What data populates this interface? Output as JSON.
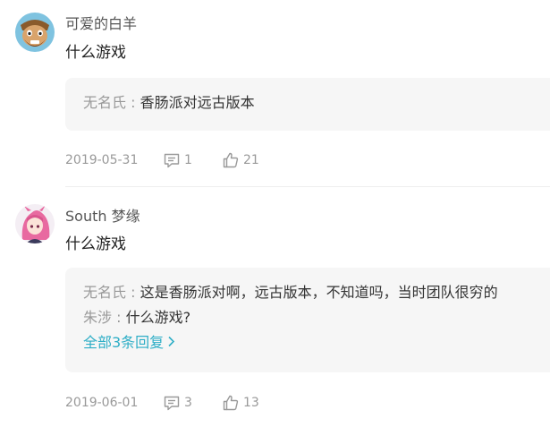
{
  "comments": [
    {
      "user": "可爱的白羊",
      "avatar_icon": "clash-character-avatar",
      "text": "什么游戏",
      "replies": [
        {
          "name": "无名氏",
          "text": "香肠派对远古版本"
        }
      ],
      "date": "2019-05-31",
      "reply_count": "1",
      "like_count": "21"
    },
    {
      "user": "South 梦缘",
      "avatar_icon": "anime-character-avatar",
      "text": "什么游戏",
      "replies": [
        {
          "name": "无名氏",
          "text": "这是香肠派对啊，远古版本，不知道吗，当时团队很穷的"
        },
        {
          "name": "朱涉",
          "text": "什么游戏?"
        }
      ],
      "view_all": "全部3条回复",
      "date": "2019-06-01",
      "reply_count": "3",
      "like_count": "13"
    }
  ],
  "separator": " : ",
  "colors": {
    "link": "#2eaec6",
    "muted": "#999999",
    "text": "#222222",
    "reply_bg": "#f6f6f6"
  }
}
